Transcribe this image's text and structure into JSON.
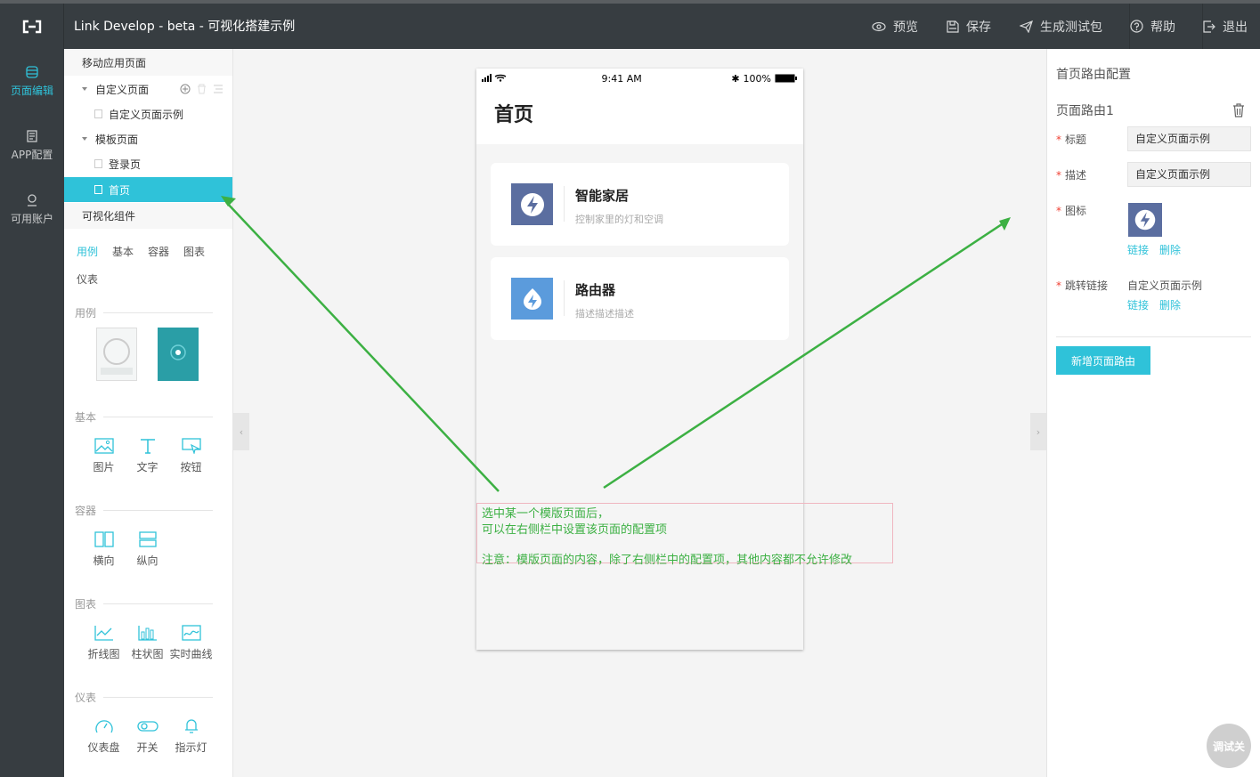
{
  "app": {
    "title": "Link Develop - beta - 可视化搭建示例"
  },
  "top_actions": [
    {
      "label": "预览",
      "icon": "eye-icon"
    },
    {
      "label": "保存",
      "icon": "save-icon"
    },
    {
      "label": "生成测试包",
      "icon": "send-icon"
    },
    {
      "label": "帮助",
      "icon": "help-icon"
    },
    {
      "label": "退出",
      "icon": "exit-icon"
    }
  ],
  "left_nav": [
    {
      "label": "页面编辑",
      "icon": "database-icon",
      "active": true
    },
    {
      "label": "APP配置",
      "icon": "document-icon",
      "active": false
    },
    {
      "label": "可用账户",
      "icon": "user-icon",
      "active": false
    }
  ],
  "page_tree": {
    "header": "移动应用页面",
    "groups": [
      {
        "label": "自定义页面",
        "items": [
          "自定义页面示例"
        ]
      },
      {
        "label": "模板页面",
        "items": [
          "登录页",
          "首页"
        ]
      }
    ],
    "selected": "首页"
  },
  "components": {
    "header": "可视化组件",
    "tabs": [
      "用例",
      "基本",
      "容器",
      "图表",
      "仪表"
    ],
    "active_tab": "用例",
    "sections": [
      {
        "title": "用例",
        "items": []
      },
      {
        "title": "基本",
        "items": [
          {
            "label": "图片",
            "icon": "image-icon"
          },
          {
            "label": "文字",
            "icon": "text-icon"
          },
          {
            "label": "按钮",
            "icon": "button-icon"
          }
        ]
      },
      {
        "title": "容器",
        "items": [
          {
            "label": "横向",
            "icon": "horizontal-layout-icon"
          },
          {
            "label": "纵向",
            "icon": "vertical-layout-icon"
          }
        ]
      },
      {
        "title": "图表",
        "items": [
          {
            "label": "折线图",
            "icon": "line-chart-icon"
          },
          {
            "label": "柱状图",
            "icon": "bar-chart-icon"
          },
          {
            "label": "实时曲线",
            "icon": "realtime-curve-icon"
          }
        ]
      },
      {
        "title": "仪表",
        "items": [
          {
            "label": "仪表盘",
            "icon": "gauge-icon"
          },
          {
            "label": "开关",
            "icon": "switch-icon"
          },
          {
            "label": "指示灯",
            "icon": "bell-icon"
          }
        ]
      }
    ]
  },
  "phone": {
    "status": {
      "time": "9:41 AM",
      "battery": "100%"
    },
    "page_title": "首页",
    "cards": [
      {
        "title": "智能家居",
        "desc": "控制家里的灯和空调",
        "icon_color": "#5b6ea0"
      },
      {
        "title": "路由器",
        "desc": "描述描述描述",
        "icon_color": "#5b9bdc"
      }
    ]
  },
  "annotation": {
    "line1": "选中某一个模版页面后，",
    "line2": "可以在右侧栏中设置该页面的配置项",
    "line3": "注意：模版页面的内容，除了右侧栏中的配置项，其他内容都不允许修改"
  },
  "config": {
    "title": "首页路由配置",
    "route_name": "页面路由1",
    "fields": {
      "title_label": "标题",
      "title_value": "自定义页面示例",
      "desc_label": "描述",
      "desc_value": "自定义页面示例",
      "icon_label": "图标",
      "jump_label": "跳转链接",
      "jump_value": "自定义页面示例"
    },
    "link_label": "链接",
    "delete_label": "删除",
    "add_button": "新增页面路由"
  },
  "debug_button": "调试关",
  "colors": {
    "accent": "#2fc2d9",
    "topbar": "#373d41",
    "annotation": "#3cb043"
  }
}
